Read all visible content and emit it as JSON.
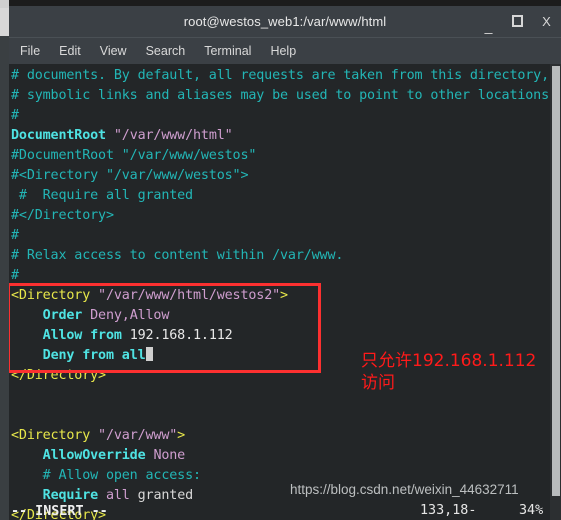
{
  "window": {
    "title": "root@westos_web1:/var/www/html",
    "buttons": {
      "minimize": "_",
      "maximize": "▫",
      "close": "X"
    }
  },
  "menubar": {
    "items": [
      {
        "label": "File"
      },
      {
        "label": "Edit"
      },
      {
        "label": "View"
      },
      {
        "label": "Search"
      },
      {
        "label": "Terminal"
      },
      {
        "label": "Help"
      }
    ]
  },
  "editor": {
    "lines": [
      {
        "id": "l1",
        "segments": [
          {
            "text": "# documents. By default, all requests are taken from this directory, but",
            "cls": "c-comment"
          }
        ]
      },
      {
        "id": "l2",
        "segments": [
          {
            "text": "# symbolic links and aliases may be used to point to other locations.",
            "cls": "c-comment"
          }
        ]
      },
      {
        "id": "l3",
        "segments": [
          {
            "text": "#",
            "cls": "c-comment"
          }
        ]
      },
      {
        "id": "l4",
        "segments": [
          {
            "text": "DocumentRoot",
            "cls": "c-directive"
          },
          {
            "text": " ",
            "cls": "c-plain"
          },
          {
            "text": "\"/var/www/html\"",
            "cls": "c-string"
          }
        ]
      },
      {
        "id": "l5",
        "segments": [
          {
            "text": "#DocumentRoot \"/var/www/westos\"",
            "cls": "c-comment"
          }
        ]
      },
      {
        "id": "l6",
        "segments": [
          {
            "text": "#<Directory \"/var/www/westos\">",
            "cls": "c-comment"
          }
        ]
      },
      {
        "id": "l7",
        "segments": [
          {
            "text": " #  Require all granted",
            "cls": "c-comment"
          }
        ]
      },
      {
        "id": "l8",
        "segments": [
          {
            "text": "#</Directory>",
            "cls": "c-comment"
          }
        ]
      },
      {
        "id": "l9",
        "segments": [
          {
            "text": "#",
            "cls": "c-comment"
          }
        ]
      },
      {
        "id": "l10",
        "segments": [
          {
            "text": "# Relax access to content within /var/www.",
            "cls": "c-comment"
          }
        ]
      },
      {
        "id": "l11",
        "segments": [
          {
            "text": "#",
            "cls": "c-comment"
          }
        ]
      },
      {
        "id": "l12",
        "segments": [
          {
            "text": "<Directory",
            "cls": "c-tag"
          },
          {
            "text": " ",
            "cls": "c-plain"
          },
          {
            "text": "\"/var/www/html/westos2\"",
            "cls": "c-string"
          },
          {
            "text": ">",
            "cls": "c-tag"
          }
        ]
      },
      {
        "id": "l13",
        "segments": [
          {
            "text": "    ",
            "cls": "c-plain"
          },
          {
            "text": "Order",
            "cls": "c-directive"
          },
          {
            "text": " ",
            "cls": "c-plain"
          },
          {
            "text": "Deny,Allow",
            "cls": "c-string"
          }
        ]
      },
      {
        "id": "l14",
        "segments": [
          {
            "text": "    ",
            "cls": "c-plain"
          },
          {
            "text": "Allow from",
            "cls": "c-directive"
          },
          {
            "text": " ",
            "cls": "c-plain"
          },
          {
            "text": "192.168.1.112",
            "cls": "c-white"
          }
        ]
      },
      {
        "id": "l15",
        "segments": [
          {
            "text": "    ",
            "cls": "c-plain"
          },
          {
            "text": "Deny from",
            "cls": "c-directive"
          },
          {
            "text": " ",
            "cls": "c-plain"
          },
          {
            "text": "all",
            "cls": "c-directive"
          }
        ],
        "cursor": true
      },
      {
        "id": "l16",
        "segments": [
          {
            "text": "</Directory>",
            "cls": "c-tag"
          }
        ]
      },
      {
        "id": "l17",
        "segments": [
          {
            "text": "",
            "cls": "c-plain"
          }
        ]
      },
      {
        "id": "l18",
        "segments": [
          {
            "text": "",
            "cls": "c-plain"
          }
        ]
      },
      {
        "id": "l19",
        "segments": [
          {
            "text": "<Directory",
            "cls": "c-tag"
          },
          {
            "text": " ",
            "cls": "c-plain"
          },
          {
            "text": "\"/var/www\"",
            "cls": "c-string"
          },
          {
            "text": ">",
            "cls": "c-tag"
          }
        ]
      },
      {
        "id": "l20",
        "segments": [
          {
            "text": "    ",
            "cls": "c-plain"
          },
          {
            "text": "AllowOverride",
            "cls": "c-directive"
          },
          {
            "text": " ",
            "cls": "c-plain"
          },
          {
            "text": "None",
            "cls": "c-string"
          }
        ]
      },
      {
        "id": "l21",
        "segments": [
          {
            "text": "    ",
            "cls": "c-plain"
          },
          {
            "text": "# Allow open access:",
            "cls": "c-comment"
          }
        ]
      },
      {
        "id": "l22",
        "segments": [
          {
            "text": "    ",
            "cls": "c-plain"
          },
          {
            "text": "Require",
            "cls": "c-directive"
          },
          {
            "text": " ",
            "cls": "c-plain"
          },
          {
            "text": "all",
            "cls": "c-string"
          },
          {
            "text": " ",
            "cls": "c-plain"
          },
          {
            "text": "granted",
            "cls": "c-plain"
          }
        ]
      },
      {
        "id": "l23",
        "segments": [
          {
            "text": "</Directory>",
            "cls": "c-tag"
          }
        ]
      }
    ]
  },
  "status": {
    "mode": "-- INSERT --",
    "position": "133,18-",
    "percent": "34%"
  },
  "annotation": {
    "line1": "只允许192.168.1.112",
    "line2": "访问",
    "color": "#ff1a1a"
  },
  "watermark": {
    "text": "https://blog.csdn.net/weixin_44632711"
  },
  "colors": {
    "terminal_bg": "#232628",
    "titlebar_bg": "#3b4045",
    "comment": "#23b6b6",
    "directive": "#4fe3e3",
    "string": "#cf9ecf",
    "tag": "#e8e84a",
    "highlight_box": "#fc3030"
  }
}
